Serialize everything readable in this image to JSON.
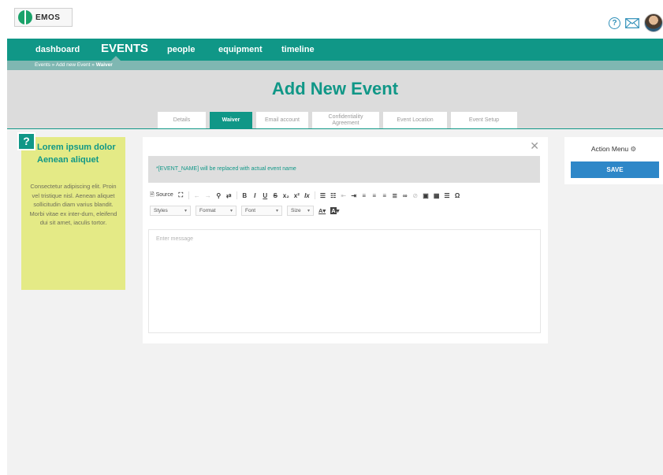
{
  "app": {
    "logo_text": "EMOS"
  },
  "nav": {
    "items": [
      {
        "label": "dashboard"
      },
      {
        "label": "EVENTS"
      },
      {
        "label": "people"
      },
      {
        "label": "equipment"
      },
      {
        "label": "timeline"
      }
    ],
    "active_index": 1
  },
  "breadcrumb": {
    "path": "Events » Add new Event » ",
    "current": "Waiver"
  },
  "header": {
    "title": "Add New Event"
  },
  "tabs": [
    {
      "label": "Details"
    },
    {
      "label": "Waiver"
    },
    {
      "label": "Email account"
    },
    {
      "label": "Confidentiality Agreement"
    },
    {
      "label": "Event Location"
    },
    {
      "label": "Event Setup"
    }
  ],
  "help_note": {
    "icon_text": "?",
    "title": "Lorem ipsum dolor Aenean aliquet",
    "body": "Consectetur adipiscing elit. Proin vel tristique nisl. Aenean aliquet sollicitudin diam varius blandit. Morbi vitae ex inter-dum, eleifend dui sit amet, iaculis tortor."
  },
  "editor": {
    "hint": "*[EVENT_NAME] will be replaced with actual event name",
    "source_label": "Source",
    "styles_label": "Styles",
    "format_label": "Format",
    "font_label": "Font",
    "size_label": "Size",
    "font_color_label": "A",
    "bg_color_label": "A",
    "placeholder": "Enter message",
    "close_symbol": "✕",
    "toolbar_glyphs": {
      "bold": "B",
      "italic": "I",
      "underline": "U",
      "strike": "S",
      "subscript": "x₂",
      "superscript": "x²",
      "remove_format": "Ix",
      "special_char": "Ω"
    }
  },
  "action_menu": {
    "title": "Action Menu",
    "save_label": "SAVE"
  },
  "colors": {
    "primary": "#109787",
    "secondary": "#7fb7b2",
    "save": "#2e87c8",
    "note": "#e4ea86"
  }
}
